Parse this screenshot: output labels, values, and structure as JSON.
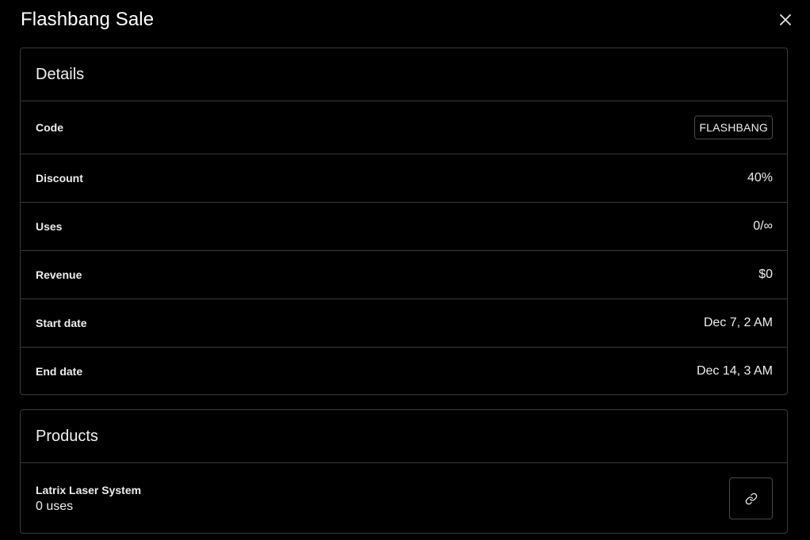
{
  "header": {
    "title": "Flashbang Sale",
    "close_icon": "close-icon"
  },
  "details": {
    "title": "Details",
    "rows": [
      {
        "label": "Code",
        "value": "FLASHBANG"
      },
      {
        "label": "Discount",
        "value": "40%"
      },
      {
        "label": "Uses",
        "value": "0/∞"
      },
      {
        "label": "Revenue",
        "value": "$0"
      },
      {
        "label": "Start date",
        "value": "Dec 7, 2 AM"
      },
      {
        "label": "End date",
        "value": "Dec 14, 3 AM"
      }
    ]
  },
  "products": {
    "title": "Products",
    "items": [
      {
        "name": "Latrix Laser System",
        "uses": "0 uses",
        "action_icon": "link-icon"
      }
    ]
  },
  "colors": {
    "background": "#000000",
    "border": "#3a3a3a",
    "text": "#ededed"
  }
}
